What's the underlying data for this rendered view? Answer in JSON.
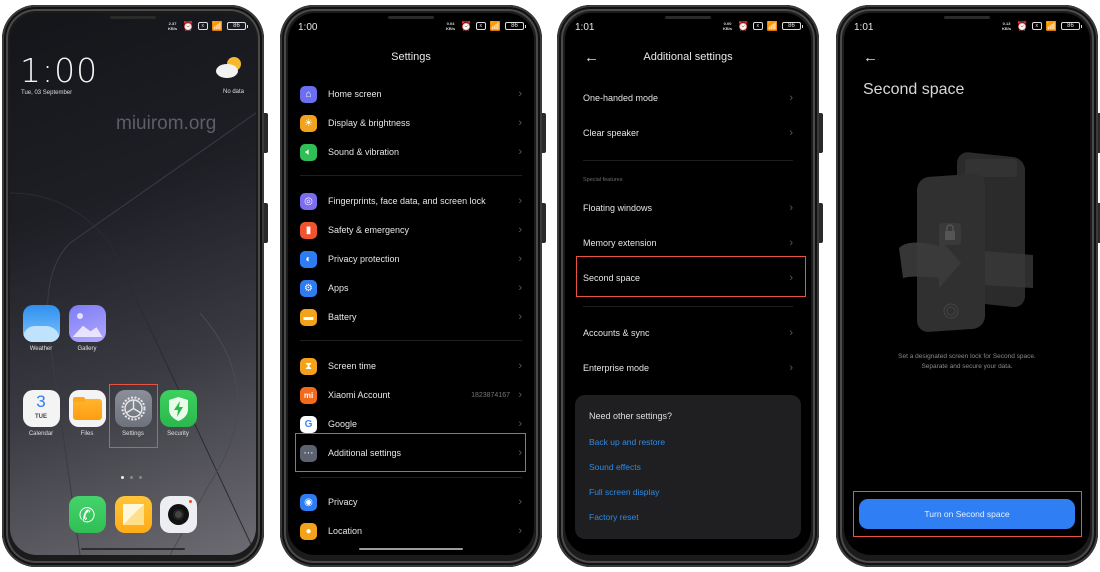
{
  "screens": [
    {
      "name": "home-screen",
      "status": {
        "speed": "2.37 KB/s",
        "battery": "86"
      },
      "clock": "1:00",
      "date": "Tue, 03 September",
      "weather": "No data",
      "watermark": "miuirom.org",
      "apps": [
        {
          "label": "Weather",
          "icon": "weather-icon"
        },
        {
          "label": "Gallery",
          "icon": "gallery-icon"
        },
        {
          "label": "Calendar",
          "icon": "calendar-icon",
          "day": "3",
          "weekday": "TUE"
        },
        {
          "label": "Files",
          "icon": "files-icon"
        },
        {
          "label": "Settings",
          "icon": "settings-gear-icon",
          "highlighted": true
        },
        {
          "label": "Security",
          "icon": "security-shield-icon"
        }
      ],
      "dock": [
        {
          "icon": "phone-icon"
        },
        {
          "icon": "notes-icon"
        },
        {
          "icon": "camera-icon"
        }
      ],
      "page_indicator": {
        "pages": 3,
        "current": 1
      }
    },
    {
      "name": "settings-screen",
      "status": {
        "time": "1:00",
        "speed": "0.04 KB/s",
        "battery": "86"
      },
      "title": "Settings",
      "items": [
        {
          "label": "Home screen",
          "icon": "home-icon",
          "color": "#6b6ef0"
        },
        {
          "label": "Display & brightness",
          "icon": "sun-icon",
          "color": "#f2a31b"
        },
        {
          "label": "Sound & vibration",
          "icon": "speaker-icon",
          "color": "#2fbf55"
        },
        {
          "label": "Fingerprints, face data, and screen lock",
          "icon": "fingerprint-icon",
          "color": "#7b6cf0"
        },
        {
          "label": "Safety & emergency",
          "icon": "safety-icon",
          "color": "#f0532e"
        },
        {
          "label": "Privacy protection",
          "icon": "privacy-protection-icon",
          "color": "#2d7cf2"
        },
        {
          "label": "Apps",
          "icon": "apps-gear-icon",
          "color": "#2d7cf2"
        },
        {
          "label": "Battery",
          "icon": "battery-icon",
          "color": "#f2a31b"
        },
        {
          "label": "Screen time",
          "icon": "hourglass-icon",
          "color": "#f2a31b"
        },
        {
          "label": "Xiaomi Account",
          "icon": "mi-icon",
          "color": "#f26a1b",
          "value": "1823874167"
        },
        {
          "label": "Google",
          "icon": "google-icon",
          "color": "#ffffff"
        },
        {
          "label": "Additional settings",
          "icon": "more-dots-icon",
          "color": "#5d6270",
          "highlighted": true
        },
        {
          "label": "Privacy",
          "icon": "eye-icon",
          "color": "#2d7cf2"
        },
        {
          "label": "Location",
          "icon": "location-pin-icon",
          "color": "#f2a31b"
        }
      ]
    },
    {
      "name": "additional-settings-screen",
      "status": {
        "time": "1:01",
        "speed": "0.00 KB/s",
        "battery": "86"
      },
      "title": "Additional settings",
      "items_top": [
        {
          "label": "One-handed mode"
        },
        {
          "label": "Clear speaker"
        }
      ],
      "section_label": "Special features",
      "items_special": [
        {
          "label": "Floating windows"
        },
        {
          "label": "Memory extension"
        },
        {
          "label": "Second space",
          "highlighted": true
        }
      ],
      "items_bottom": [
        {
          "label": "Accounts & sync"
        },
        {
          "label": "Enterprise mode"
        }
      ],
      "card": {
        "title": "Need other settings?",
        "links": [
          "Back up and restore",
          "Sound effects",
          "Full screen display",
          "Factory reset"
        ]
      }
    },
    {
      "name": "second-space-screen",
      "status": {
        "time": "1:01",
        "speed": "0.13 KB/s",
        "battery": "86"
      },
      "title": "Second space",
      "description_line1": "Set a designated screen lock for Second space.",
      "description_line2": "Separate and secure your data.",
      "button": "Turn on Second space"
    }
  ],
  "colors": {
    "highlight": "#e8523f",
    "accent_blue": "#2f7ef4",
    "link_blue": "#2d8ae8"
  }
}
